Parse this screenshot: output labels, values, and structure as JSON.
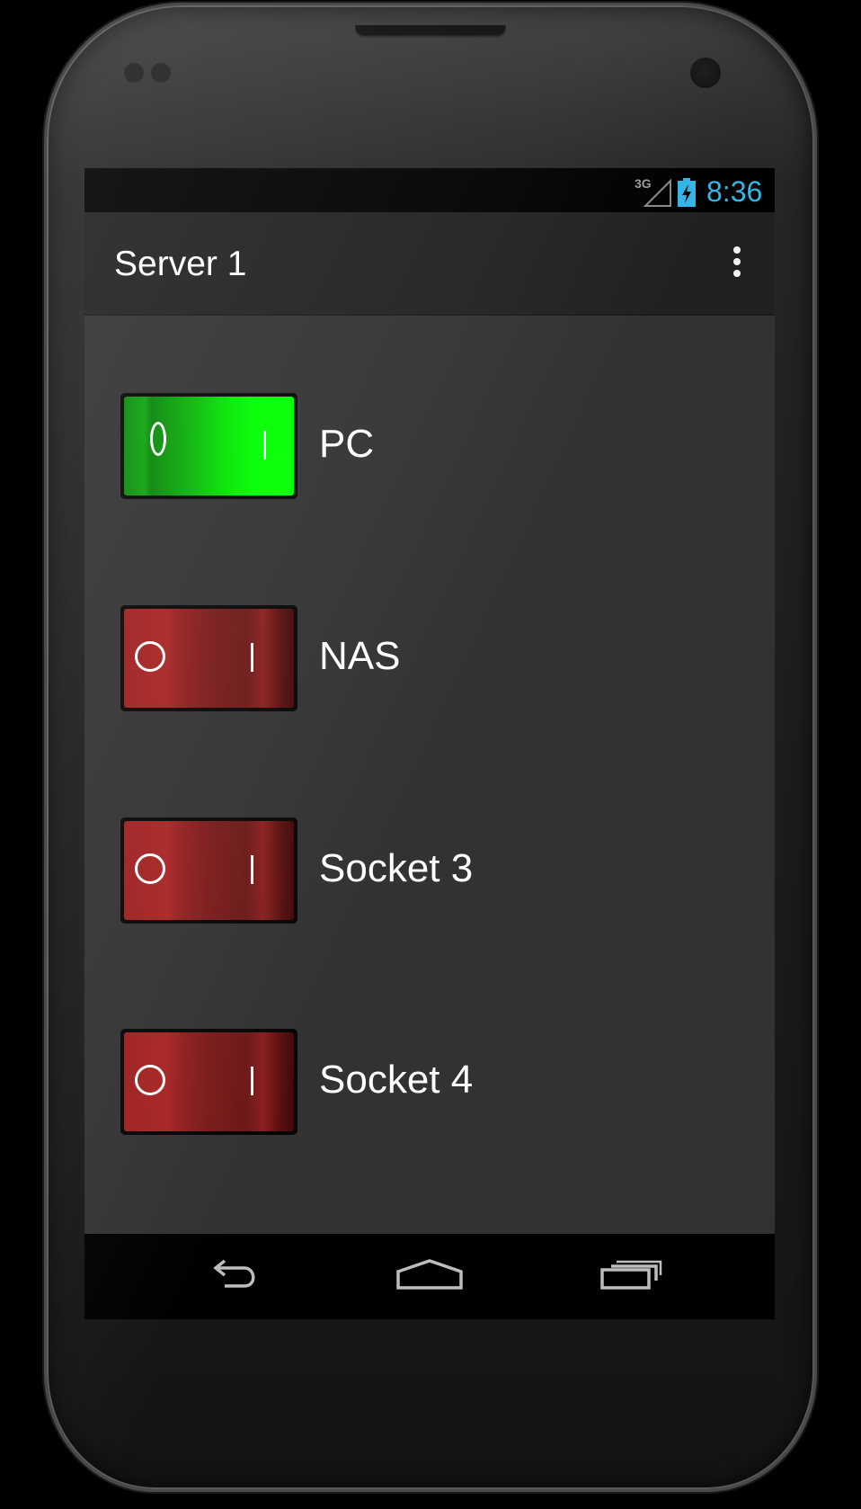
{
  "status_bar": {
    "network_type": "3G",
    "time": "8:36",
    "icons": [
      "signal-icon",
      "battery-charging-icon"
    ],
    "clock_color": "#33b5e5"
  },
  "action_bar": {
    "title": "Server 1",
    "overflow_icon": "more-vert-icon"
  },
  "switches": [
    {
      "label": "PC",
      "state": "on",
      "off_symbol": "0",
      "on_symbol": "I",
      "color": "#00ff00"
    },
    {
      "label": "NAS",
      "state": "off",
      "off_symbol": "O",
      "on_symbol": "I",
      "color": "#a82424"
    },
    {
      "label": "Socket 3",
      "state": "off",
      "off_symbol": "O",
      "on_symbol": "I",
      "color": "#a82424"
    },
    {
      "label": "Socket 4",
      "state": "off",
      "off_symbol": "O",
      "on_symbol": "I",
      "color": "#a82424"
    }
  ],
  "nav_bar": {
    "buttons": [
      "back-icon",
      "home-icon",
      "recent-apps-icon"
    ]
  }
}
